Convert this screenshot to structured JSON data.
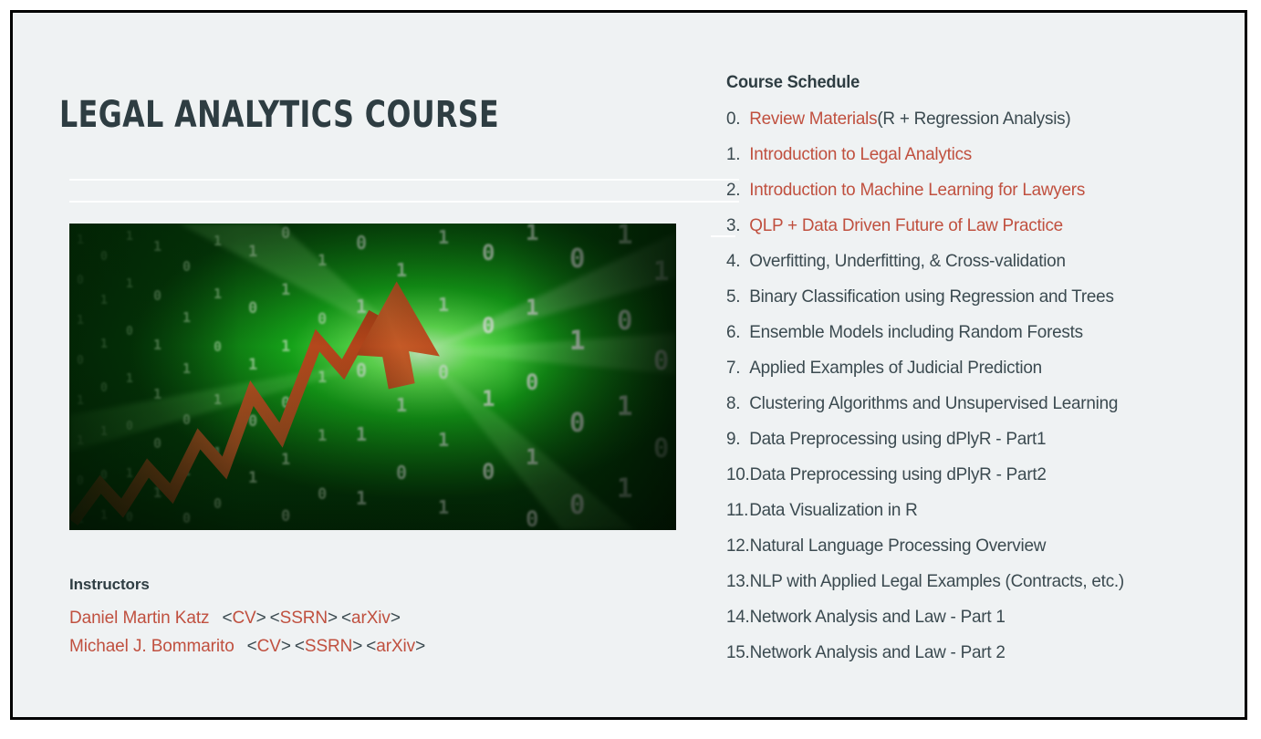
{
  "page": {
    "title": "LEGAL ANALYTICS COURSE",
    "background_color": "#eff2f3",
    "border_color": "#000000",
    "link_color": "#c0503f",
    "text_color": "#3b4a50",
    "heading_color": "#2e3d42"
  },
  "hero": {
    "alt": "green binary code background with orange upward trending zigzag arrow",
    "icon_name": "data-growth-arrow-image"
  },
  "instructors": {
    "heading": "Instructors",
    "people": [
      {
        "name": "Daniel Martin Katz",
        "links": [
          "CV",
          "SSRN",
          "arXiv"
        ]
      },
      {
        "name": "Michael J. Bommarito",
        "links": [
          "CV",
          "SSRN",
          "arXiv"
        ]
      }
    ],
    "bracket_open": "<",
    "bracket_close": ">"
  },
  "schedule": {
    "heading": "Course Schedule",
    "items": [
      {
        "num": "0.",
        "text": "Review Materials",
        "suffix": " (R + Regression Analysis)",
        "is_link": true
      },
      {
        "num": "1.",
        "text": "Introduction to Legal Analytics",
        "suffix": "",
        "is_link": true
      },
      {
        "num": "2.",
        "text": "Introduction to Machine Learning for Lawyers",
        "suffix": "",
        "is_link": true
      },
      {
        "num": "3.",
        "text": "QLP + Data Driven Future of Law Practice",
        "suffix": "",
        "is_link": true
      },
      {
        "num": "4.",
        "text": "Overfitting, Underfitting, & Cross-validation",
        "suffix": "",
        "is_link": false
      },
      {
        "num": "5.",
        "text": " Binary Classification using Regression and Trees",
        "suffix": "",
        "is_link": false
      },
      {
        "num": "6.",
        "text": " Ensemble Models including Random Forests",
        "suffix": "",
        "is_link": false
      },
      {
        "num": "7.",
        "text": " Applied Examples of Judicial Prediction",
        "suffix": "",
        "is_link": false
      },
      {
        "num": "8.",
        "text": " Clustering Algorithms and Unsupervised Learning",
        "suffix": "",
        "is_link": false
      },
      {
        "num": "9.",
        "text": " Data Preprocessing using dPlyR - Part1",
        "suffix": "",
        "is_link": false
      },
      {
        "num": "10.",
        "text": "Data Preprocessing using dPlyR - Part2",
        "suffix": "",
        "is_link": false
      },
      {
        "num": "11.",
        "text": "Data Visualization in R",
        "suffix": "",
        "is_link": false
      },
      {
        "num": "12.",
        "text": "Natural Language Processing Overview",
        "suffix": "",
        "is_link": false
      },
      {
        "num": "13.",
        "text": "NLP with Applied Legal Examples (Contracts, etc.)",
        "suffix": "",
        "is_link": false
      },
      {
        "num": "14.",
        "text": "Network Analysis and Law - Part 1",
        "suffix": "",
        "is_link": false
      },
      {
        "num": "15.",
        "text": "Network Analysis and Law - Part 2",
        "suffix": "",
        "is_link": false
      }
    ]
  }
}
